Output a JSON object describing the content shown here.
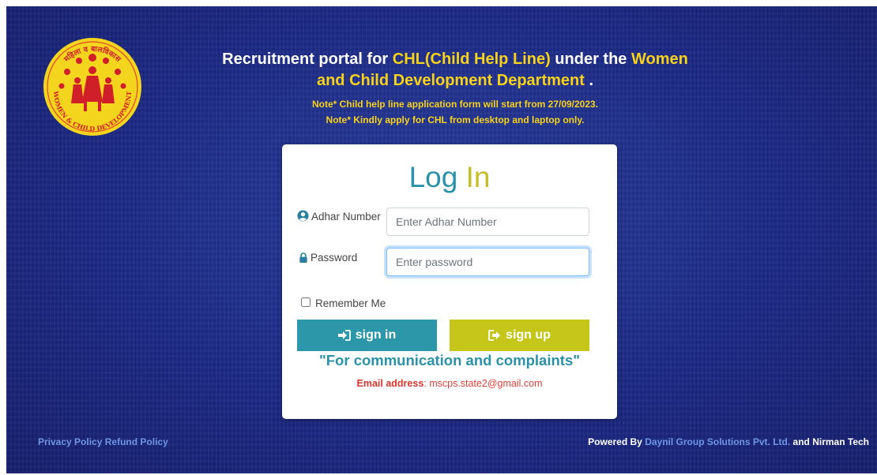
{
  "header": {
    "logo_alt": "WOMEN & CHILD DEVELOPMENT",
    "logo_top_text": "महिला व बालविकास",
    "logo_bottom_text": "WOMEN & CHILD DEVELOPMENT",
    "title_part1": "Recruitment portal for ",
    "title_highlight1": "CHL(Child Help Line)",
    "title_part2": " under the ",
    "title_highlight2_line1": "Women",
    "title_highlight2_line2": "and Child Development Department",
    "title_part3": " .",
    "note1": "Note* Child help line application form will start from 27/09/2023.",
    "note2": "Note* Kindly apply for CHL from desktop and laptop only."
  },
  "login": {
    "title_a": "Log",
    "title_b": "In",
    "adhar_label": "Adhar Number",
    "adhar_placeholder": "Enter Adhar Number",
    "adhar_value": "",
    "password_label": "Password",
    "password_placeholder": "Enter password",
    "password_value": "",
    "remember_label": "Remember Me",
    "remember_checked": false,
    "signin_label": "sign in",
    "signup_label": "sign up",
    "communication_text": "\"For communication and complaints\"",
    "email_label": "Email address",
    "email_value": ": mscps.state2@gmail.com"
  },
  "footer": {
    "privacy_link": "Privacy Policy",
    "refund_link": "Refund Policy",
    "powered_by": "Powered By ",
    "company_link": "Daynil Group Solutions Pvt. Ltd.",
    "and_text": " and Nirman Tech"
  },
  "colors": {
    "background": "#1d2a86",
    "accent_yellow": "#f6d21c",
    "teal": "#2b97a8",
    "olive": "#c6c61a",
    "email_red": "#e0413a",
    "link_blue": "#6f95e4"
  },
  "icons": {
    "adhar": "user-circle-icon",
    "password": "lock-icon",
    "signin": "sign-in-icon",
    "signup": "sign-out-icon"
  }
}
